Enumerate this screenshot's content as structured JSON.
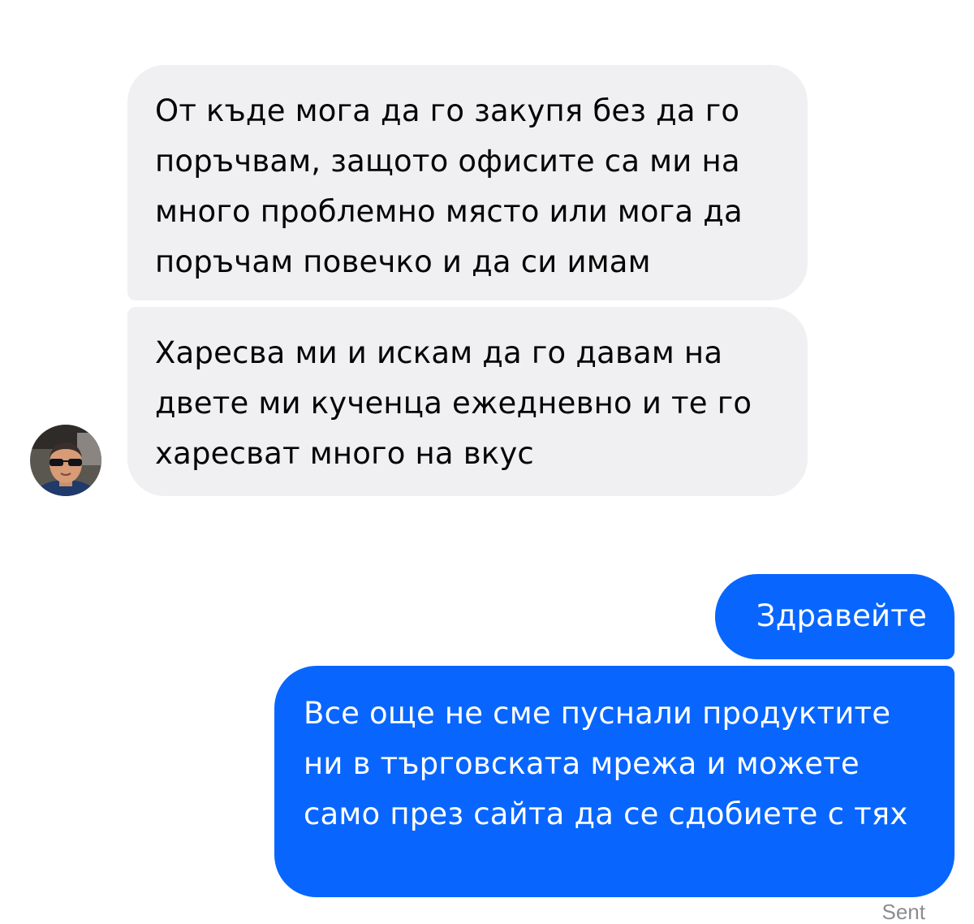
{
  "conversation": {
    "incoming_messages": [
      "От къде мога да го закупя без да го поръчвам, защото офисите са ми на много проблемно място или мога да поръчам повечко и да си имам",
      "Харесва ми и искам да го давам на двете ми кученца ежедневно и те го харесват много на вкус"
    ],
    "outgoing_messages": [
      "Здравейте",
      "Все още не сме пуснали продуктите ни в търговската мрежа и можете само през сайта да се сдобиете с тях"
    ],
    "status": "Sent"
  },
  "contact": {
    "avatar_icon": "profile-photo-icon"
  },
  "colors": {
    "incoming_bubble": "#f0f0f2",
    "outgoing_bubble": "#0866ff",
    "incoming_text": "#050505",
    "outgoing_text": "#ffffff",
    "status_text": "#8a8d91"
  }
}
